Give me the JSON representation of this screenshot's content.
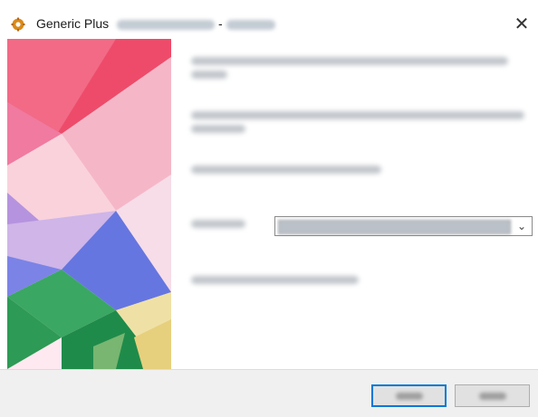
{
  "window": {
    "title": "Generic Plus",
    "title_separator": " - ",
    "close_glyph": "✕",
    "app_icon": "gear-icon"
  },
  "content": {
    "dropdown_arrow": "⌄"
  },
  "colors": {
    "accent": "#0078d7",
    "footer_bg": "#f0f0f0",
    "banner_red": "#ea3d5e",
    "banner_pink": "#f4a3bc",
    "banner_blue": "#5b6fe0",
    "banner_purple": "#b48ad8",
    "banner_green": "#2aa05a",
    "banner_yellow": "#eedb9c"
  }
}
